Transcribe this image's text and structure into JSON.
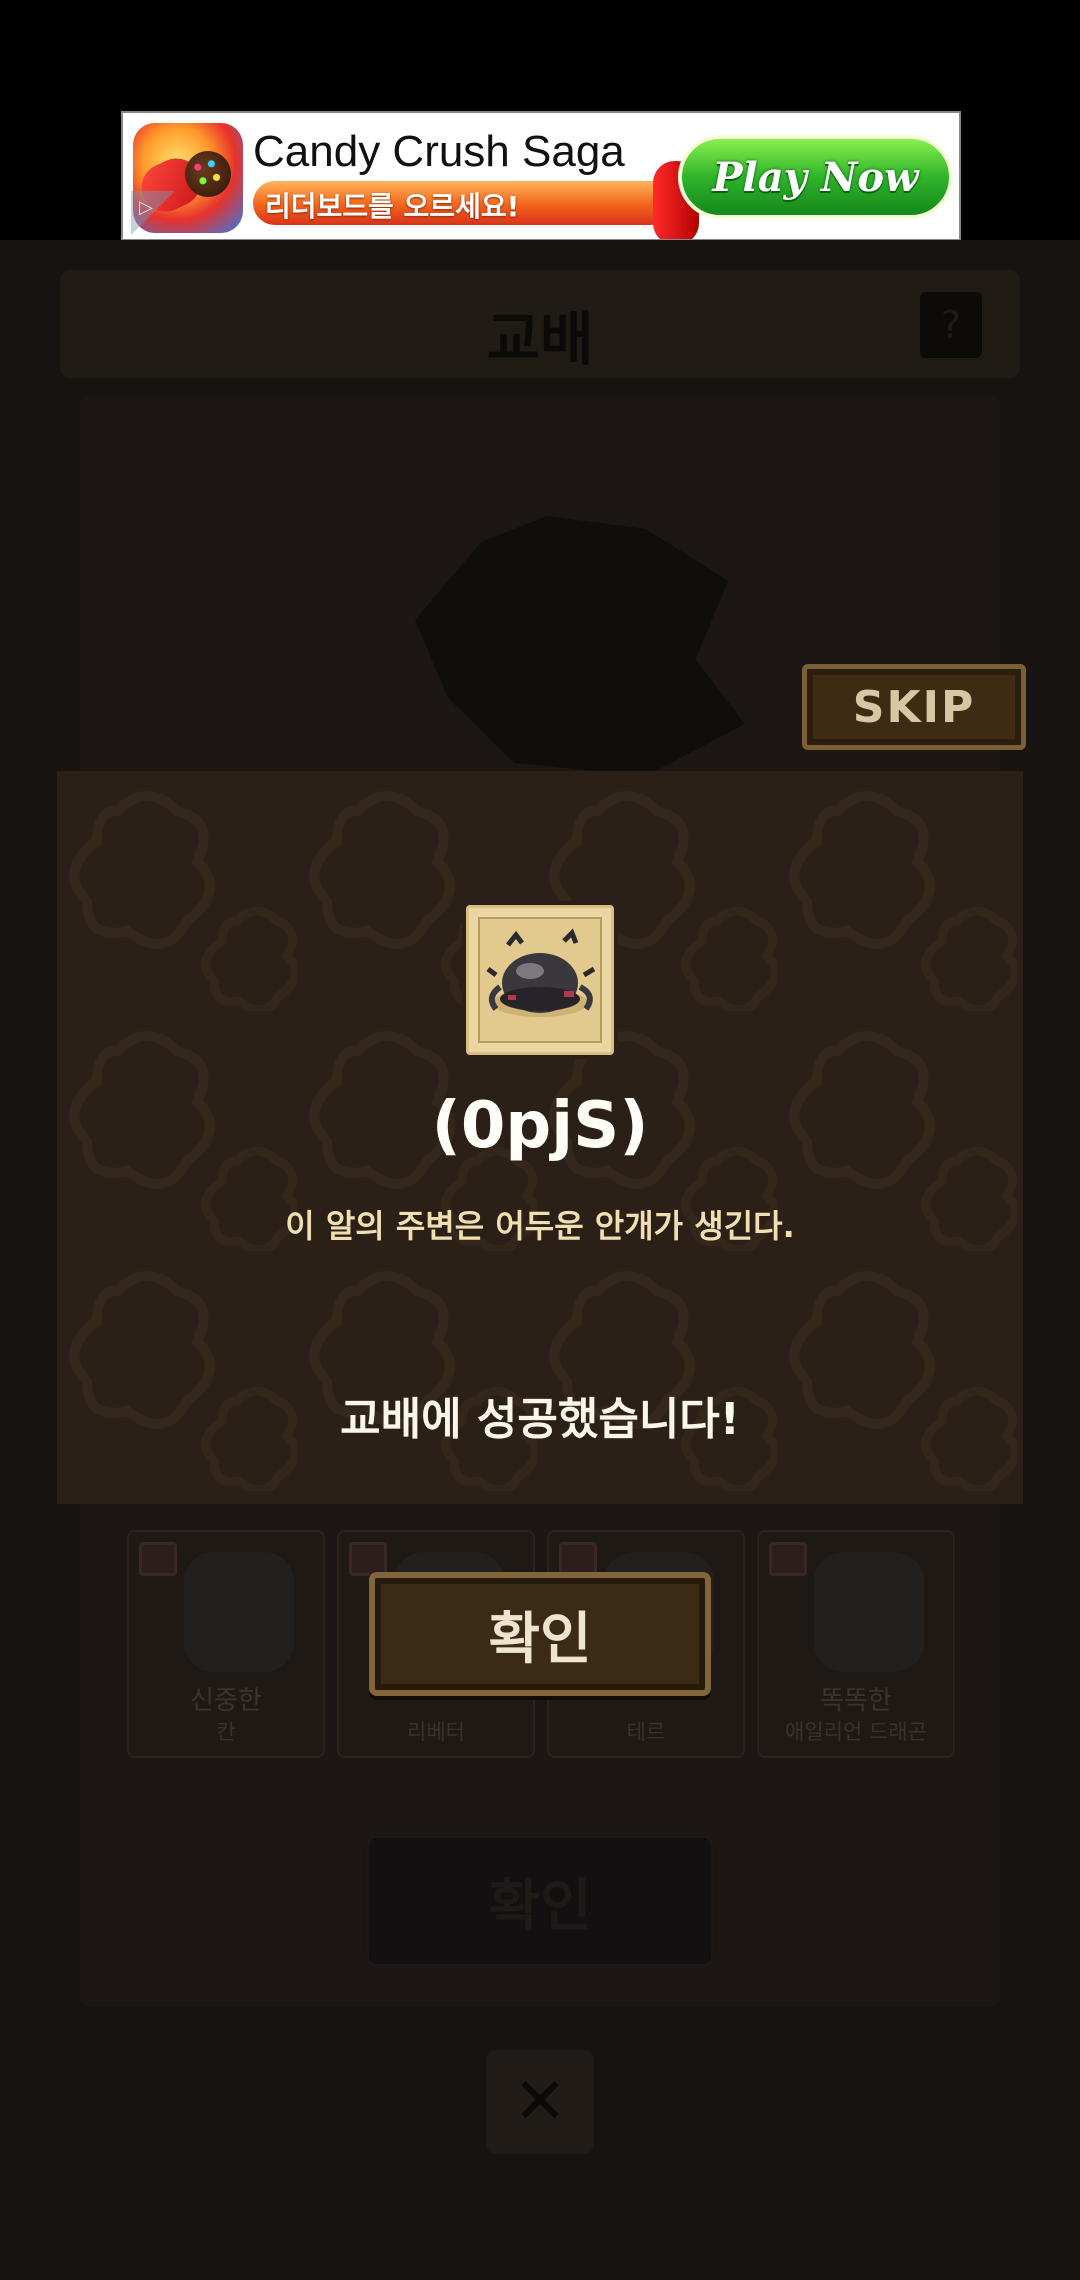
{
  "ad": {
    "title": "Candy Crush Saga",
    "subtitle": "리더보드를 오르세요!",
    "cta_label": "Play Now",
    "badge_glyph": "▷",
    "icon_name": "candy-crush-app-icon"
  },
  "screen": {
    "title": "교배",
    "help_label": "?",
    "skip_label": "SKIP",
    "background_confirm_label": "확인",
    "close_glyph": "✕"
  },
  "dragon_cards": [
    {
      "name": "신중한",
      "sub": "칸"
    },
    {
      "name": "",
      "sub": "리베터"
    },
    {
      "name": "",
      "sub": "테르"
    },
    {
      "name": "똑똑한",
      "sub": "애일리언 드래곤"
    }
  ],
  "result": {
    "item_icon": "dark-egg-icon",
    "item_name": "(0pjS)",
    "item_description": "이 알의 주변은 어두운 안개가 생긴다.",
    "success_message": "교배에 성공했습니다!",
    "confirm_label": "확인"
  },
  "colors": {
    "modal_bg": "#2b2017",
    "button_gold_border": "#82653a",
    "item_frame": "#ead7a4"
  }
}
